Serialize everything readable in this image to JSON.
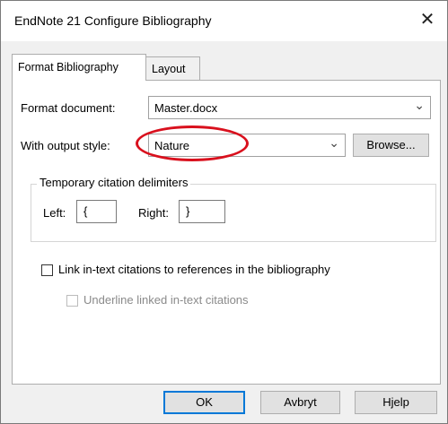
{
  "window": {
    "title": "EndNote 21 Configure Bibliography"
  },
  "tabs": [
    {
      "label": "Format Bibliography",
      "active": true
    },
    {
      "label": "Layout",
      "active": false
    }
  ],
  "format_document": {
    "label": "Format document:",
    "value": "Master.docx"
  },
  "output_style": {
    "label": "With output style:",
    "value": "Nature",
    "browse_label": "Browse..."
  },
  "delimiters": {
    "group_label": "Temporary citation delimiters",
    "left_label": "Left:",
    "left_value": "{",
    "right_label": "Right:",
    "right_value": "}"
  },
  "options": {
    "link_label": "Link in-text citations to references in the bibliography",
    "link_checked": false,
    "underline_label": "Underline linked in-text citations",
    "underline_checked": false,
    "underline_enabled": false
  },
  "buttons": {
    "ok": "OK",
    "cancel": "Avbryt",
    "help": "Hjelp"
  },
  "colors": {
    "accent": "#0078d7",
    "annotation": "#d9101d"
  }
}
